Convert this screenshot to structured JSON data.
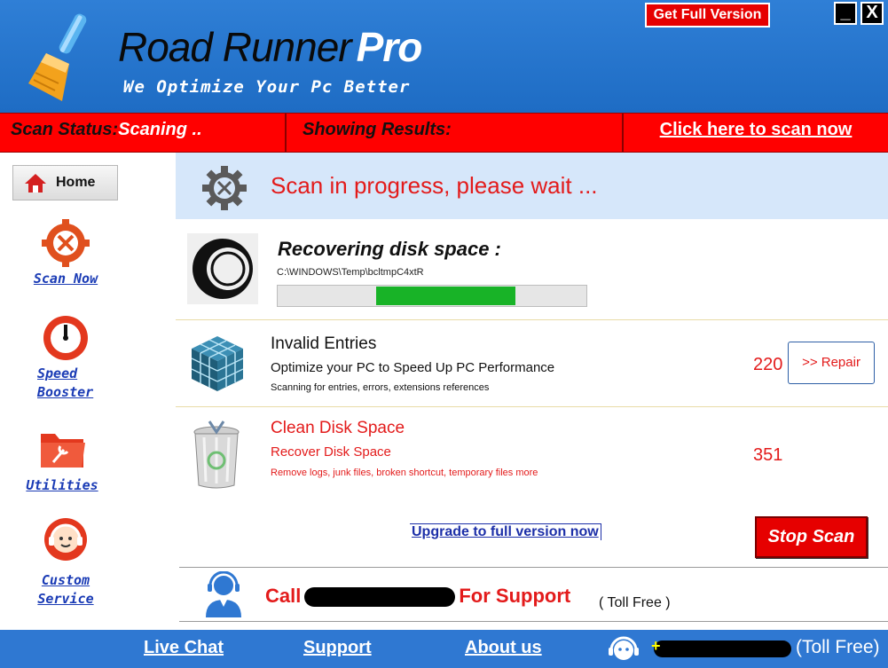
{
  "header": {
    "title_main": "Road Runner",
    "title_pro": "Pro",
    "tagline": "We Optimize Your Pc Better",
    "get_full_label": "Get Full Version",
    "minimize_label": "_",
    "close_label": "X"
  },
  "status": {
    "scan_status_label": "Scan Status:",
    "scan_status_value": "Scaning ..",
    "showing_results_label": "Showing Results:",
    "scan_now_link": "Click here to scan now"
  },
  "sidebar": {
    "home_label": "Home",
    "items": [
      {
        "label_lines": [
          "Scan Now"
        ],
        "icon": "gear-wrench-icon"
      },
      {
        "label_lines": [
          "Speed",
          "Booster"
        ],
        "icon": "speedometer-icon"
      },
      {
        "label_lines": [
          "Utilities"
        ],
        "icon": "folder-tools-icon"
      },
      {
        "label_lines": [
          "Custom",
          "Service"
        ],
        "icon": "headset-icon"
      }
    ]
  },
  "main": {
    "progress_message": "Scan in progress, please wait ...",
    "recovering": {
      "title": "Recovering disk space :",
      "path": "C:\\WINDOWS\\Temp\\bcltmpC4xtR",
      "progress_start": 0.32,
      "progress_end": 0.77
    },
    "invalid_entries": {
      "title": "Invalid Entries",
      "subtitle": "Optimize your PC to Speed Up PC Performance",
      "detail": "Scanning for entries, errors, extensions  references",
      "count": "220",
      "repair_label": ">> Repair"
    },
    "clean_disk": {
      "title": "Clean Disk Space",
      "subtitle": "Recover Disk Space",
      "detail": "Remove logs, junk files, broken shortcut, temporary files  more",
      "count": "351"
    },
    "upgrade_link": "Upgrade to full version now",
    "stop_label": "Stop Scan",
    "support": {
      "call_prefix": "Call",
      "call_suffix": "For Support",
      "toll_free": "( Toll Free )"
    }
  },
  "footer": {
    "live_chat": "Live Chat",
    "support": "Support",
    "about_us": "About us",
    "toll_free": "(Toll Free)"
  },
  "colors": {
    "header_blue": "#2f7fd6",
    "status_red": "#ff0000",
    "accent_red": "#e31b1b",
    "progress_green": "#18b327",
    "link_blue": "#1a3bb5",
    "panel_light_blue": "#d6e7fa"
  }
}
